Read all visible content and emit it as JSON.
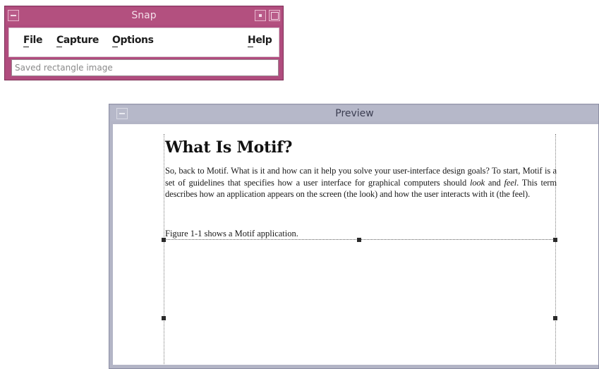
{
  "snap_window": {
    "title": "Snap",
    "menu": {
      "file": "File",
      "capture": "Capture",
      "options": "Options",
      "help": "Help"
    },
    "status_text": "Saved rectangle image"
  },
  "preview_window": {
    "title": "Preview",
    "document": {
      "heading": "What Is Motif?",
      "paragraph_start": "So, back to Motif. What is it and how can it help you solve your user-interface design goals? To start, Motif is a set of guidelines that specifies how a user interface for graphical computers should ",
      "italic_look": "look",
      "and_word": " and ",
      "italic_feel": "feel",
      "paragraph_end": ". This term describes how an application appears on the screen (the look) and how the user interacts with it (the feel).",
      "caption": "Figure 1-1 shows a Motif application."
    }
  },
  "colors": {
    "snap_frame": "#b04c7e",
    "preview_frame": "#b3b5c6"
  }
}
